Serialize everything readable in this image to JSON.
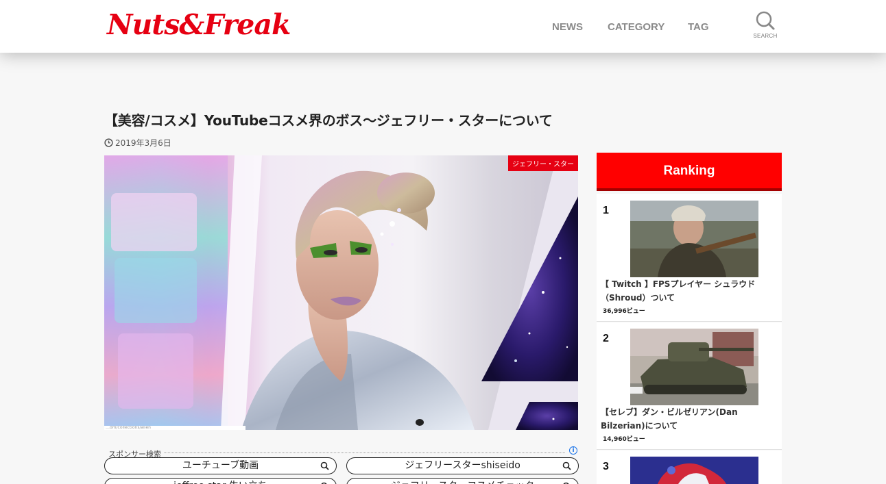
{
  "header": {
    "logo": "Nuts&Freak",
    "nav": [
      "NEWS",
      "CATEGORY",
      "TAG"
    ],
    "search_label": "SEARCH"
  },
  "article": {
    "title": "【美容/コスメ】YouTubeコスメ界のボス〜ジェフリー・スターについて",
    "date": "2019年3月6日",
    "category_badge": "ジェフリー・スター",
    "image_caption": "…om/collections/alien"
  },
  "sponsor": {
    "heading": "スポンサー検索",
    "info_icon": "i",
    "searches": [
      "ユーチューブ動画",
      "ジェフリースターshiseido",
      "jeffree star 生い立ち",
      "ジェフリースターコスメチェック"
    ]
  },
  "ranking": {
    "heading": "Ranking",
    "items": [
      {
        "rank": "1",
        "title": "【 Twitch 】FPSプレイヤー シュラウド（Shroud）ついて",
        "views": "36,996ビュー"
      },
      {
        "rank": "2",
        "title": "【セレブ】ダン・ビルゼリアン(Dan Bilzerian)について",
        "views": "14,960ビュー"
      },
      {
        "rank": "3",
        "title": "",
        "views": ""
      }
    ]
  },
  "colors": {
    "brand_red": "#e60012",
    "ranking_red": "#ff0000",
    "nav_gray": "#8a8a8a",
    "info_blue": "#1a73e8"
  },
  "icons": {
    "search": "search-icon",
    "clock": "clock-icon",
    "info": "info-icon"
  }
}
